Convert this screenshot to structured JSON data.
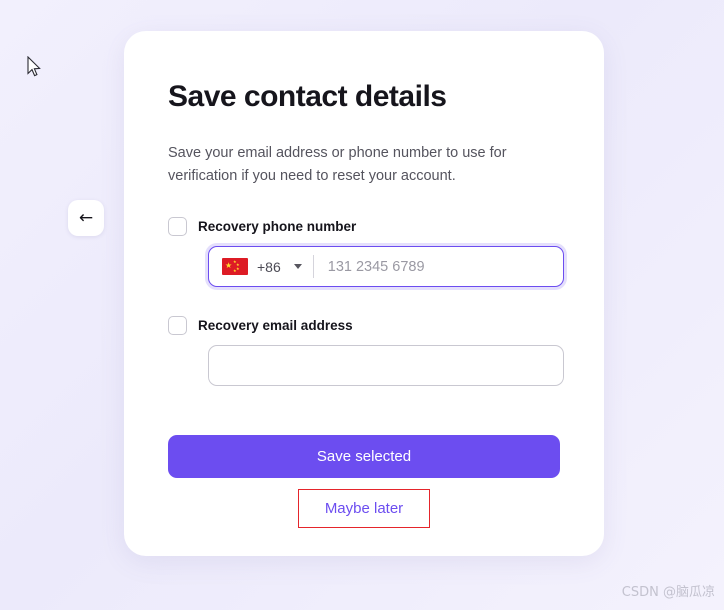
{
  "background": {
    "color": "#f0eefc"
  },
  "accent": {
    "purple": "#6c4df0",
    "annotation_red": "#e5252b"
  },
  "back_button": {
    "icon": "arrow-left-icon",
    "glyph": "←"
  },
  "card": {
    "title": "Save contact details",
    "subtitle": "Save your email address or phone number to use for verification if you need to reset your account.",
    "phone_field": {
      "label": "Recovery phone number",
      "checkbox_checked": false,
      "country_flag": "china-flag-icon",
      "country_code": "+86",
      "caret_icon": "chevron-down-icon",
      "placeholder": "131 2345 6789",
      "value": "",
      "focused": true
    },
    "email_field": {
      "label": "Recovery email address",
      "checkbox_checked": false,
      "placeholder": "",
      "value": ""
    },
    "primary_button": {
      "label": "Save selected"
    },
    "secondary_button": {
      "label": "Maybe later",
      "annotated": true
    }
  },
  "watermark": {
    "text": "CSDN @脑瓜凉"
  },
  "cursor": {
    "icon": "mouse-pointer-icon"
  }
}
